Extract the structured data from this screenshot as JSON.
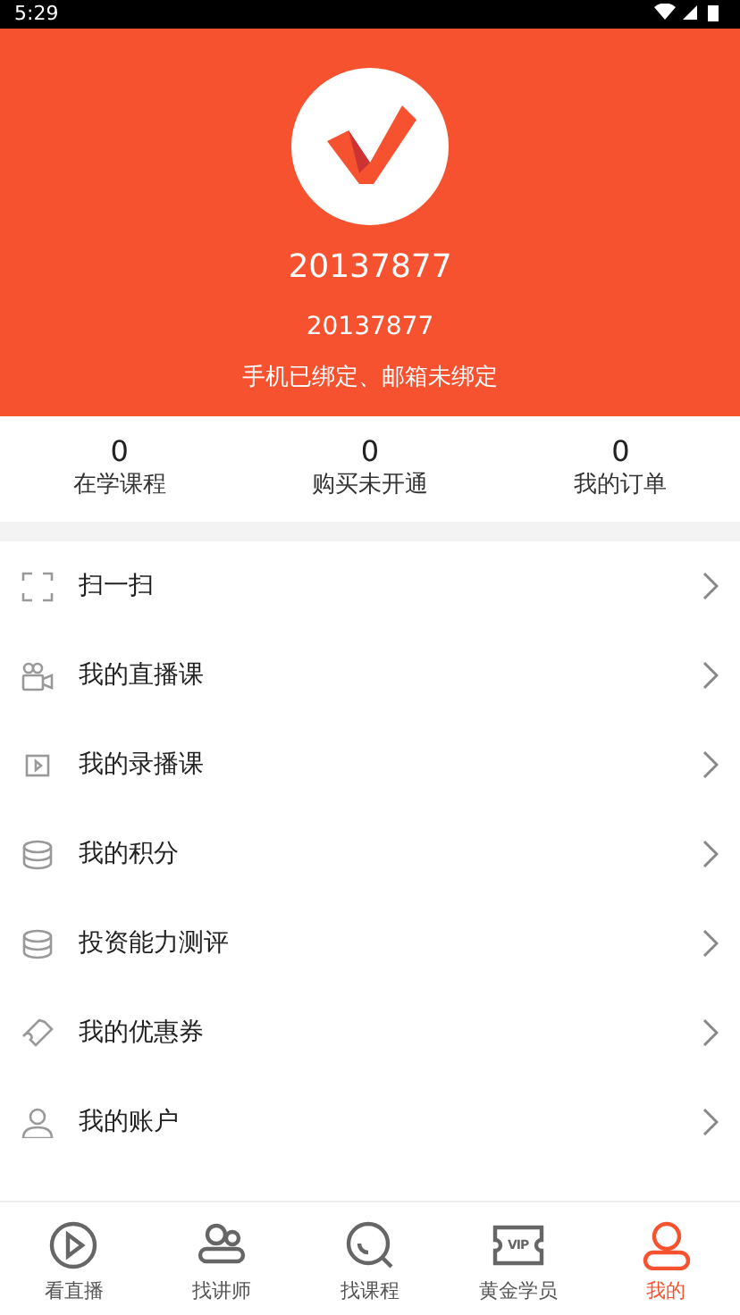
{
  "status_bar": {
    "time": "5:29"
  },
  "profile": {
    "name": "20137877",
    "user_id": "20137877",
    "binding": "手机已绑定、邮箱未绑定"
  },
  "stats": [
    {
      "value": "0",
      "label": "在学课程"
    },
    {
      "value": "0",
      "label": "购买未开通"
    },
    {
      "value": "0",
      "label": "我的订单"
    }
  ],
  "menu": [
    {
      "kind": "scan",
      "label": "扫一扫"
    },
    {
      "kind": "live",
      "label": "我的直播课"
    },
    {
      "kind": "video",
      "label": "我的录播课"
    },
    {
      "kind": "coins",
      "label": "我的积分"
    },
    {
      "kind": "coins",
      "label": "投资能力测评"
    },
    {
      "kind": "coupon",
      "label": "我的优惠券"
    },
    {
      "kind": "user",
      "label": "我的账户"
    }
  ],
  "tab_bar": [
    {
      "kind": "play",
      "label": "看直播",
      "selected": false
    },
    {
      "kind": "people",
      "label": "找讲师",
      "selected": false
    },
    {
      "kind": "search",
      "label": "找课程",
      "selected": false
    },
    {
      "kind": "vip",
      "label": "黄金学员",
      "icon_text": "VIP",
      "selected": false
    },
    {
      "kind": "user",
      "label": "我的",
      "selected": true
    }
  ]
}
